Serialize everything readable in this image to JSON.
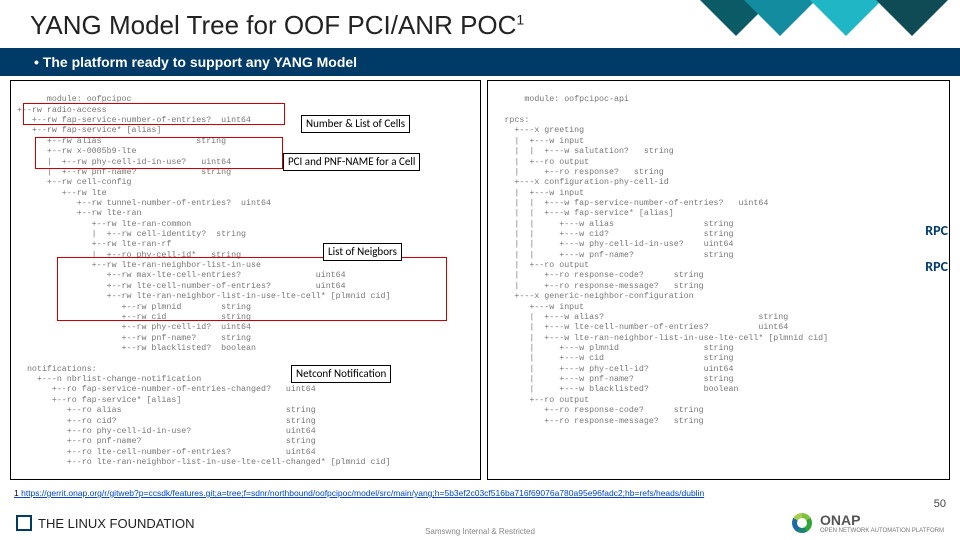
{
  "title": "YANG Model Tree for OOF PCI/ANR POC",
  "title_sup": "1",
  "subtitle": "The platform ready to support any YANG Model",
  "left_tree": "module: oofpcipoc\n+--rw radio-access\n   +--rw fap-service-number-of-entries?  uint64\n   +--rw fap-service* [alias]\n      +--rw alias                   string\n      +--rw x-0005b9-lte\n      |  +--rw phy-cell-id-in-use?   uint64\n      |  +--rw pnf-name?             string\n      +--rw cell-config\n         +--rw lte\n            +--rw tunnel-number-of-entries?  uint64\n            +--rw lte-ran\n               +--rw lte-ran-common\n               |  +--rw cell-identity?  string\n               +--rw lte-ran-rf\n               |  +--ro phy-cell-id*   string\n               +--rw lte-ran-neighbor-list-in-use\n                  +--rw max-lte-cell-entries?               uint64\n                  +--rw lte-cell-number-of-entries?         uint64\n                  +--rw lte-ran-neighbor-list-in-use-lte-cell* [plmnid cid]\n                     +--rw plmnid        string\n                     +--rw cid           string\n                     +--rw phy-cell-id?  uint64\n                     +--rw pnf-name?     string\n                     +--rw blacklisted?  boolean\n\n  notifications:\n    +---n nbrlist-change-notification\n       +--ro fap-service-number-of-entries-changed?   uint64\n       +--ro fap-service* [alias]\n          +--ro alias                                 string\n          +--ro cid?                                  string\n          +--ro phy-cell-id-in-use?                   uint64\n          +--ro pnf-name?                             string\n          +--ro lte-cell-number-of-entries?           uint64\n          +--ro lte-ran-neighbor-list-in-use-lte-cell-changed* [plmnid cid]",
  "right_tree": "module: oofpcipoc-api\n\n  rpcs:\n    +---x greeting\n    |  +---w input\n    |  |  +---w salutation?   string\n    |  +--ro output\n    |     +--ro response?   string\n    +---x configuration-phy-cell-id\n    |  +---w input\n    |  |  +---w fap-service-number-of-entries?   uint64\n    |  |  +---w fap-service* [alias]\n    |  |     +---w alias                  string\n    |  |     +---w cid?                   string\n    |  |     +---w phy-cell-id-in-use?    uint64\n    |  |     +---w pnf-name?              string\n    |  +--ro output\n    |     +--ro response-code?      string\n    |     +--ro response-message?   string\n    +---x generic-neighbor-configuration\n       +---w input\n       |  +---w alias?                               string\n       |  +---w lte-cell-number-of-entries?          uint64\n       |  +---w lte-ran-neighbor-list-in-use-lte-cell* [plmnid cid]\n       |     +---w plmnid                 string\n       |     +---w cid                    string\n       |     +---w phy-cell-id?           uint64\n       |     +---w pnf-name?              string\n       |     +---w blacklisted?           boolean\n       +--ro output\n          +--ro response-code?      string\n          +--ro response-message?   string",
  "callouts": {
    "cells": "Number & List of Cells",
    "pci": "PCI and PNF-NAME for a Cell",
    "neighbors": "List of Neigbors",
    "netconf": "Netconf Notification"
  },
  "rpc_label": "RPC",
  "footnote_num": "1",
  "footnote_url": "https://gerrit.onap.org/r/gitweb?p=ccsdk/features.git;a=tree;f=sdnr/northbound/oofpcipoc/model/src/main/yang;h=5b3ef2c03cf516ba716f69076a780a95e96fadc2;hb=refs/heads/dublin",
  "page_number": "50",
  "classification": "Samswng Internal & Restricted",
  "footer": {
    "linux_foundation": "THE LINUX FOUNDATION",
    "onap": "ONAP",
    "onap_sub": "OPEN NETWORK AUTOMATION PLATFORM"
  }
}
